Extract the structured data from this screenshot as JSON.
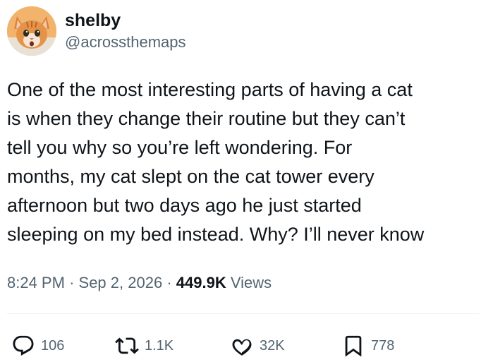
{
  "user": {
    "display_name": "shelby",
    "handle": "@acrossthemaps",
    "avatar_icon": "orange-cat-avatar"
  },
  "tweet": {
    "text": "One of the most interesting parts of having a cat\nis when they change their routine but they can’t\ntell you why so you’re left wondering. For\nmonths, my cat slept on the cat tower every\nafternoon but two days ago he just started\nsleeping on my bed instead. Why? I’ll never know",
    "time": "8:24 PM",
    "separator": "·",
    "date": "Sep 2, 2026",
    "views_count": "449.9K",
    "views_label": "Views"
  },
  "actions": {
    "replies": "106",
    "reposts": "1.1K",
    "likes": "32K",
    "bookmarks": "778",
    "reply_icon": "reply-bubble-icon",
    "repost_icon": "repost-arrows-icon",
    "like_icon": "heart-icon",
    "bookmark_icon": "bookmark-icon"
  },
  "colors": {
    "text": "#0f1419",
    "secondary": "#536471",
    "divider": "#eff3f4",
    "avatar_bg": "#e8a25a"
  }
}
